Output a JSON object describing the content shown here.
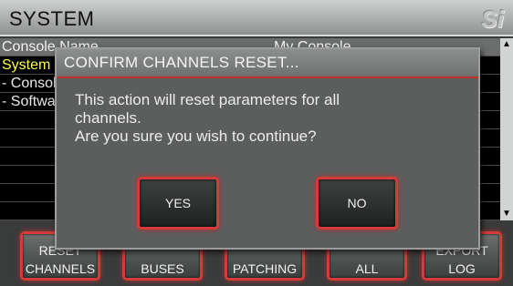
{
  "window": {
    "title": "SYSTEM",
    "logo": "Si"
  },
  "list": {
    "header_left": "Console Name",
    "header_right": "My Console",
    "rows": [
      "System",
      "- Console",
      "- Software",
      "",
      "",
      "",
      "",
      "",
      ""
    ]
  },
  "softkeys": [
    {
      "line1": "RESET",
      "line2": "CHANNELS"
    },
    {
      "line1": "",
      "line2": "BUSES"
    },
    {
      "line1": "",
      "line2": "PATCHING"
    },
    {
      "line1": "",
      "line2": "ALL"
    },
    {
      "line1": "EXPORT",
      "line2": "LOG"
    }
  ],
  "dialog": {
    "title": "CONFIRM CHANNELS RESET...",
    "message_line1": "This action will reset parameters for all",
    "message_line2": "channels.",
    "message_line3": "Are you sure you wish to continue?",
    "yes_label": "YES",
    "no_label": "NO"
  },
  "colors": {
    "accent_red": "#d43a3a",
    "selected_text": "#ffff40",
    "dialog_bg": "#5c5e5e"
  }
}
